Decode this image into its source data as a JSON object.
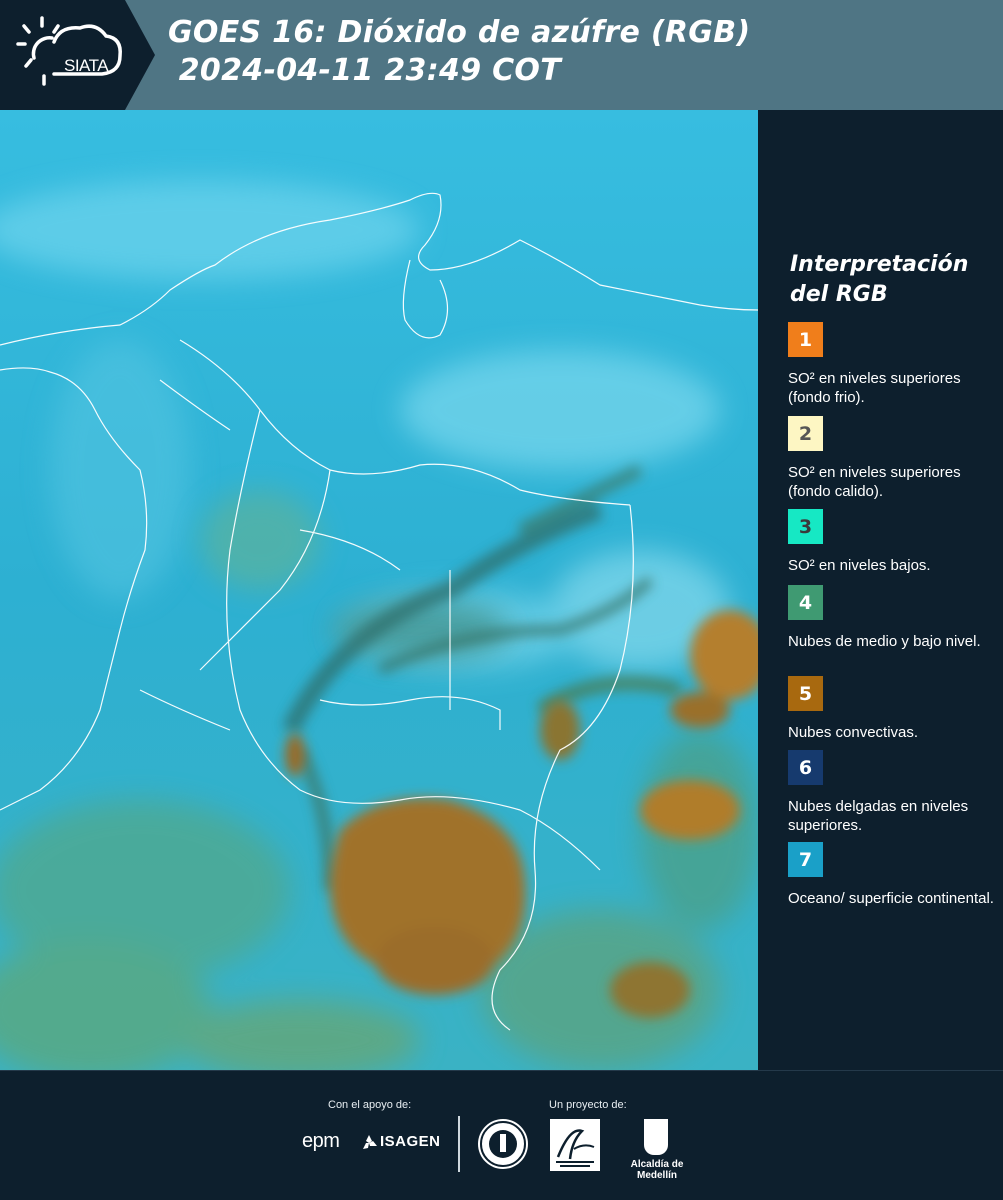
{
  "header": {
    "logo_text": "SIATA",
    "title_line1": "GOES 16: Dióxido de azúfre (RGB)",
    "title_line2": " 2024-04-11 23:49 COT"
  },
  "legend": {
    "title_line1": "Interpretación",
    "title_line2": "del RGB",
    "items": [
      {
        "number": "1",
        "color": "#f07e1b",
        "text_color": "#ffffff",
        "description": "SO² en niveles superiores (fondo frio)."
      },
      {
        "number": "2",
        "color": "#fdf6c3",
        "text_color": "#555555",
        "description": "SO² en niveles superiores (fondo calido)."
      },
      {
        "number": "3",
        "color": "#16e8c4",
        "text_color": "#3a3a3a",
        "description": "SO² en niveles bajos."
      },
      {
        "number": "4",
        "color": "#3f9a72",
        "text_color": "#ffffff",
        "description": "Nubes de medio y bajo nivel."
      },
      {
        "number": "5",
        "color": "#a8690f",
        "text_color": "#ffffff",
        "description": "Nubes convectivas."
      },
      {
        "number": "6",
        "color": "#163a6e",
        "text_color": "#ffffff",
        "description": "Nubes delgadas en niveles superiores."
      },
      {
        "number": "7",
        "color": "#1aa0c8",
        "text_color": "#ffffff",
        "description": "Oceano/ superficie continental."
      }
    ]
  },
  "footer": {
    "support_label": "Con el apoyo de:",
    "project_label": "Un proyecto de:",
    "sponsor1": "epm",
    "sponsor2": "ISAGEN",
    "partner3": "Alcaldía de Medellín"
  },
  "colors": {
    "background": "#0d1f2d",
    "header": "#4f7584",
    "ocean": "#2fb6d6",
    "convective": "#a8690f"
  }
}
